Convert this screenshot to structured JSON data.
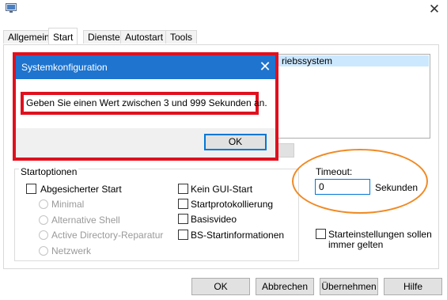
{
  "tabs": [
    {
      "label": "Allgemein",
      "active": false
    },
    {
      "label": "Start",
      "active": true
    },
    {
      "label": "Dienste",
      "active": false
    },
    {
      "label": "Autostart",
      "active": false
    },
    {
      "label": "Tools",
      "active": false
    }
  ],
  "boot_list": {
    "selected_entry_partial": "riebssystem"
  },
  "startoptions": {
    "group_label": "Startoptionen",
    "safe_boot": {
      "label": "Abgesicherter Start",
      "checked": false
    },
    "radios": [
      {
        "label": "Minimal",
        "enabled": false
      },
      {
        "label": "Alternative Shell",
        "enabled": false
      },
      {
        "label": "Active Directory-Reparatur",
        "enabled": false
      },
      {
        "label": "Netzwerk",
        "enabled": false
      }
    ],
    "right_checks": [
      {
        "label": "Kein GUI-Start",
        "checked": false
      },
      {
        "label": "Startprotokollierung",
        "checked": false
      },
      {
        "label": "Basisvideo",
        "checked": false
      },
      {
        "label": "BS-Startinformationen",
        "checked": false
      }
    ]
  },
  "timeout": {
    "label": "Timeout:",
    "value": "0",
    "unit": "Sekunden"
  },
  "permanent": {
    "line1": "Starteinstellungen sollen",
    "line2": "immer gelten",
    "checked": false
  },
  "buttons": {
    "ok": "OK",
    "cancel": "Abbrechen",
    "apply": "Übernehmen",
    "help": "Hilfe"
  },
  "dialog": {
    "title": "Systemkonfiguration",
    "message": "Geben Sie einen Wert zwischen 3 und 999 Sekunden an.",
    "ok": "OK"
  },
  "colors": {
    "dialog_title_bg": "#1e74cf",
    "highlight_red": "#e0101e",
    "highlight_orange": "#f08a24",
    "selection": "#cce8ff"
  }
}
